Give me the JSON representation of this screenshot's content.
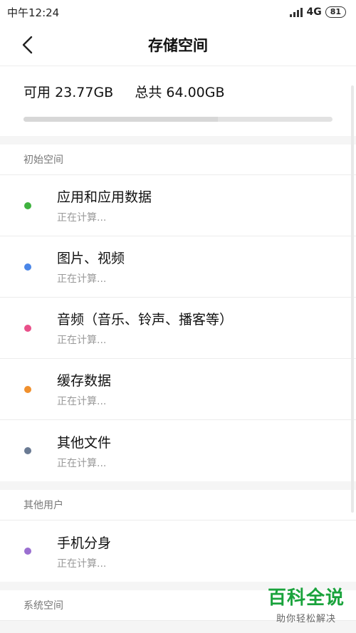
{
  "statusbar": {
    "time": "中午12:24",
    "network": "4G",
    "battery": "81"
  },
  "header": {
    "title": "存储空间"
  },
  "summary": {
    "available_label": "可用",
    "available_value": "23.77GB",
    "total_label": "总共",
    "total_value": "64.00GB",
    "used_fraction": 0.63
  },
  "sections": [
    {
      "title": "初始空间",
      "items": [
        {
          "label": "应用和应用数据",
          "status": "正在计算...",
          "color": "#3fb23f"
        },
        {
          "label": "图片、视频",
          "status": "正在计算...",
          "color": "#4a86e8"
        },
        {
          "label": "音频（音乐、铃声、播客等）",
          "status": "正在计算...",
          "color": "#e9508a"
        },
        {
          "label": "缓存数据",
          "status": "正在计算...",
          "color": "#f0902d"
        },
        {
          "label": "其他文件",
          "status": "正在计算...",
          "color": "#6a7a93"
        }
      ]
    },
    {
      "title": "其他用户",
      "items": [
        {
          "label": "手机分身",
          "status": "正在计算...",
          "color": "#9a6fd0"
        }
      ]
    },
    {
      "title": "系统空间",
      "items": []
    }
  ],
  "watermark": {
    "main": "百科全说",
    "sub": "助你轻松解决"
  }
}
